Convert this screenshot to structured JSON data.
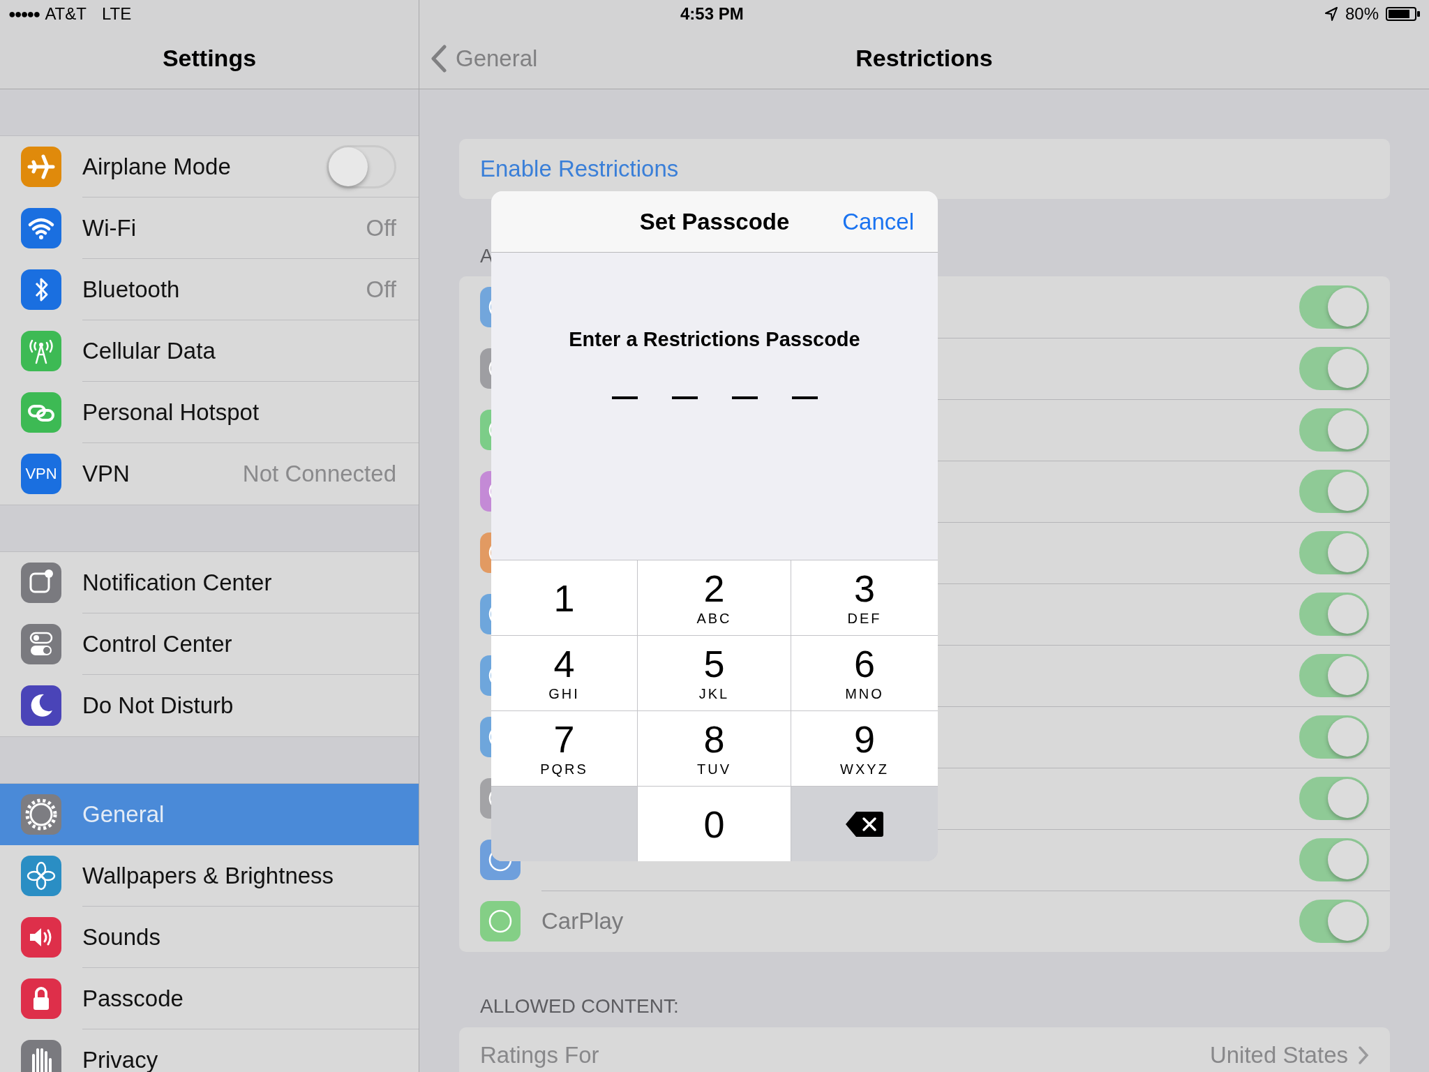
{
  "status_bar": {
    "signal": "●●●●●",
    "carrier": "AT&T",
    "network": "LTE",
    "time": "4:53 PM",
    "battery": "80%"
  },
  "sidebar": {
    "title": "Settings",
    "groups": [
      {
        "items": [
          {
            "label": "Airplane Mode",
            "kind": "toggle",
            "on": false,
            "selected": false,
            "color": "#e08a0b"
          },
          {
            "label": "Wi-Fi",
            "kind": "detail",
            "value": "Off",
            "selected": false,
            "color": "#1a6fe0"
          },
          {
            "label": "Bluetooth",
            "kind": "detail",
            "value": "Off",
            "selected": false,
            "color": "#1a6fe0"
          },
          {
            "label": "Cellular Data",
            "kind": "detail",
            "selected": false,
            "color": "#3dba54"
          },
          {
            "label": "Personal Hotspot",
            "kind": "detail",
            "selected": false,
            "color": "#3dba54"
          },
          {
            "label": "VPN",
            "kind": "detail",
            "value": "Not Connected",
            "icon_text": "VPN",
            "selected": false,
            "color": "#1a6fe0"
          }
        ]
      },
      {
        "items": [
          {
            "label": "Notification Center",
            "kind": "detail",
            "selected": false,
            "color": "#7a7a7f"
          },
          {
            "label": "Control Center",
            "kind": "detail",
            "selected": false,
            "color": "#7a7a7f"
          },
          {
            "label": "Do Not Disturb",
            "kind": "detail",
            "selected": false,
            "color": "#4a44b8"
          }
        ]
      },
      {
        "items": [
          {
            "label": "General",
            "kind": "detail",
            "selected": true,
            "color": "#7d7d82"
          },
          {
            "label": "Wallpapers & Brightness",
            "kind": "detail",
            "selected": false,
            "color": "#2a8ec4"
          },
          {
            "label": "Sounds",
            "kind": "detail",
            "selected": false,
            "color": "#de2f4a"
          },
          {
            "label": "Passcode",
            "kind": "detail",
            "selected": false,
            "color": "#de2f4a"
          },
          {
            "label": "Privacy",
            "kind": "detail",
            "selected": false,
            "color": "#7a7a7f"
          }
        ]
      }
    ]
  },
  "detail": {
    "back": "General",
    "title": "Restrictions",
    "enable_button": "Enable Restrictions",
    "allow_header": "A",
    "allow_rows": [
      {
        "on": true,
        "disabled": true,
        "color": "#72a6dc"
      },
      {
        "on": true,
        "disabled": true,
        "color": "#9e9ea2"
      },
      {
        "on": true,
        "disabled": true,
        "color": "#7ccd88"
      },
      {
        "on": true,
        "disabled": true,
        "color": "#c48ad6"
      },
      {
        "on": true,
        "disabled": true,
        "color": "#e29a62"
      },
      {
        "on": true,
        "disabled": true,
        "color": "#6ea6dc"
      },
      {
        "on": true,
        "disabled": true,
        "color": "#6ea6dc"
      },
      {
        "on": true,
        "disabled": true,
        "color": "#6ea6dc"
      },
      {
        "on": true,
        "disabled": true,
        "color": "#a3a3a6"
      },
      {
        "on": true,
        "disabled": true,
        "color": "#6e9fdc"
      },
      {
        "label": "CarPlay",
        "on": true,
        "disabled": true,
        "color": "#84cf86"
      }
    ],
    "content_header": "ALLOWED CONTENT:",
    "ratings": {
      "label": "Ratings For",
      "value": "United States"
    }
  },
  "passcode_sheet": {
    "title": "Set Passcode",
    "cancel": "Cancel",
    "prompt": "Enter a Restrictions Passcode",
    "slots": [
      {
        "filled": false
      },
      {
        "filled": false
      },
      {
        "filled": false
      },
      {
        "filled": false
      }
    ],
    "keys": [
      {
        "kind": "digit",
        "digit": "1"
      },
      {
        "kind": "digit",
        "digit": "2",
        "letters": "ABC"
      },
      {
        "kind": "digit",
        "digit": "3",
        "letters": "DEF"
      },
      {
        "kind": "digit",
        "digit": "4",
        "letters": "GHI"
      },
      {
        "kind": "digit",
        "digit": "5",
        "letters": "JKL"
      },
      {
        "kind": "digit",
        "digit": "6",
        "letters": "MNO"
      },
      {
        "kind": "digit",
        "digit": "7",
        "letters": "PQRS"
      },
      {
        "kind": "digit",
        "digit": "8",
        "letters": "TUV"
      },
      {
        "kind": "digit",
        "digit": "9",
        "letters": "WXYZ"
      },
      {
        "kind": "blank"
      },
      {
        "kind": "digit",
        "digit": "0"
      },
      {
        "kind": "delete"
      }
    ]
  }
}
